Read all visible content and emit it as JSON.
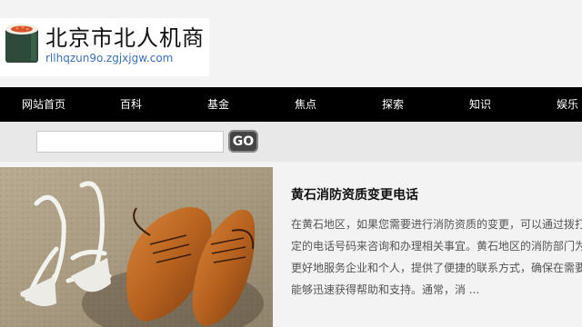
{
  "site": {
    "title": "北京市北人机商",
    "domain": "rllhqzun9o.zgjxjgw.com"
  },
  "nav": {
    "items": [
      {
        "label": "网站首页"
      },
      {
        "label": "百科"
      },
      {
        "label": "基金"
      },
      {
        "label": "焦点"
      },
      {
        "label": "探索"
      },
      {
        "label": "知识"
      },
      {
        "label": "娱乐"
      }
    ]
  },
  "search": {
    "value": "",
    "placeholder": "",
    "button_label": "GO"
  },
  "article": {
    "title": "黄石消防资质变更电话",
    "summary_lines": [
      "在黄石地区，如果您需要进行消防资质的变更，可以通过拨打",
      "定的电话号码来咨询和办理相关事宜。黄石地区的消防部门为",
      "更好地服务企业和个人，提供了便捷的联系方式，确保在需要",
      "能够迅速获得帮助和支持。通常，消 ..."
    ]
  }
}
